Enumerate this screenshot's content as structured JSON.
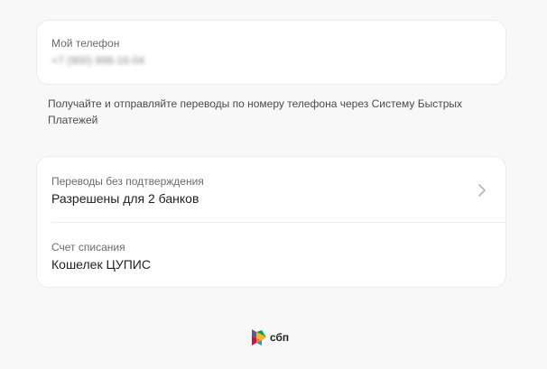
{
  "phone": {
    "caption": "Мой телефон",
    "value": "+7 (900) 998-16-04"
  },
  "hint": "Получайте и отправляйте переводы по номеру телефона через Систему Быстрых Платежей",
  "settings": {
    "transfers": {
      "caption": "Переводы без подтверждения",
      "value": "Разрешены для 2 банков"
    },
    "account": {
      "caption": "Счет списания",
      "value": "Кошелек ЦУПИС"
    }
  },
  "logo": {
    "text": "сбп",
    "icon": "sbp-logo-icon"
  },
  "colors": {
    "background": "#f8f8f8",
    "card": "#ffffff",
    "caption": "#6b6b6b",
    "text": "#1f1f1f"
  }
}
